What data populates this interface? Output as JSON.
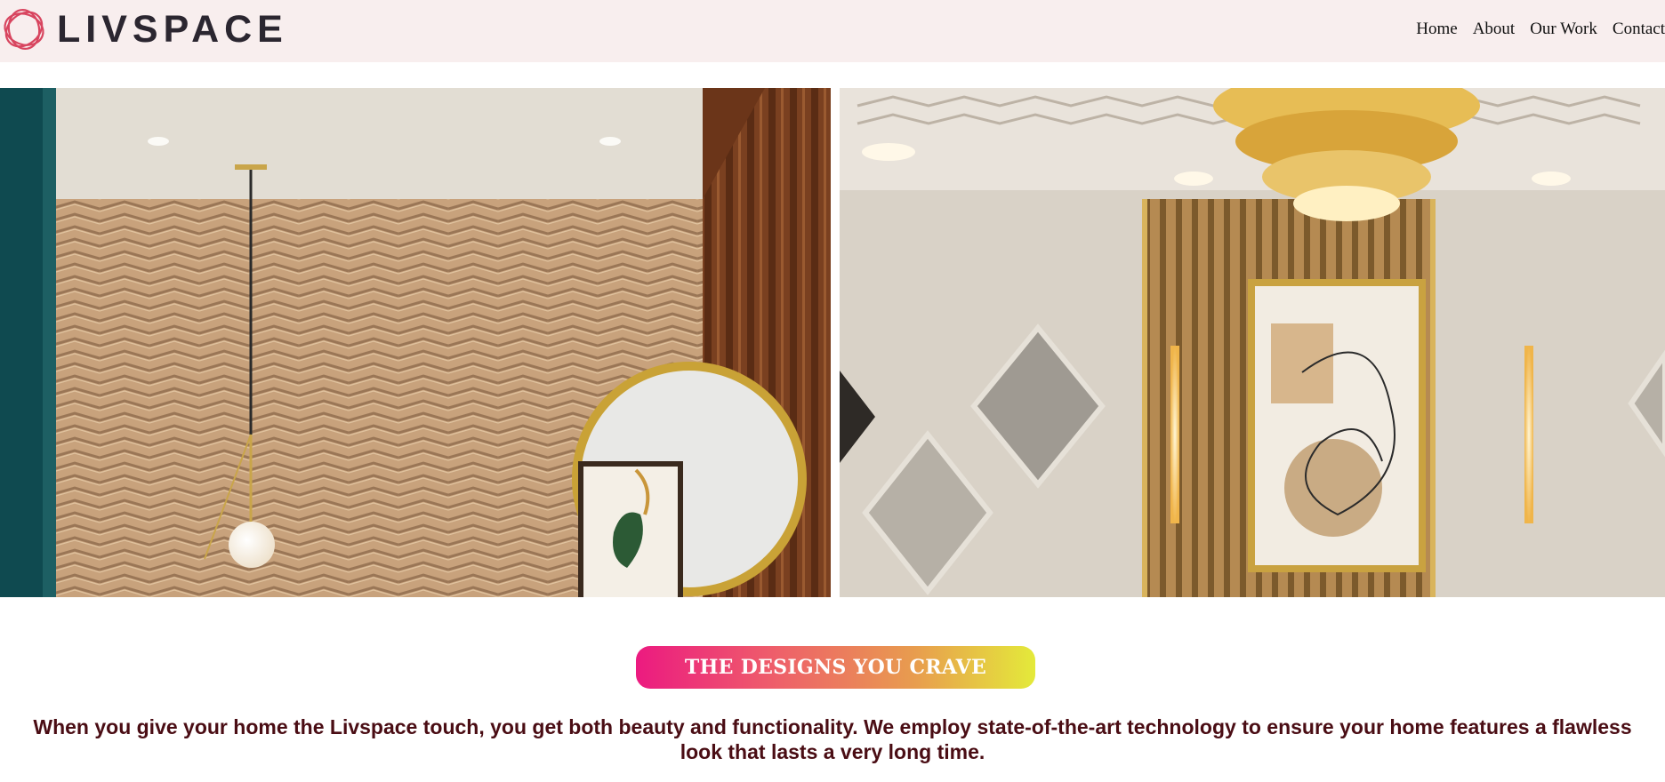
{
  "brand": {
    "name": "LIVSPACE",
    "logo_icon": "livspace-knot-logo",
    "logo_color": "#d8455f"
  },
  "nav": {
    "items": [
      {
        "label": "Home"
      },
      {
        "label": "About"
      },
      {
        "label": "Our Work"
      },
      {
        "label": "Contact"
      }
    ]
  },
  "hero": {
    "images": [
      {
        "subject": "herringbone-wall-round-mirror-pendant-lamp"
      },
      {
        "subject": "chandelier-gold-panel-mirror-wall"
      }
    ]
  },
  "section": {
    "tagline": "THE DESIGNS YOU CRAVE",
    "tagline_gradient": [
      "#ec1a80",
      "#e4ea3a"
    ],
    "description": "When you give your home the Livspace touch, you get both beauty and functionality. We employ state-of-the-art technology to ensure your home features a flawless look that lasts a very long time."
  },
  "colors": {
    "header_bg": "#f8eeee",
    "text_dark": "#4a0d14"
  }
}
